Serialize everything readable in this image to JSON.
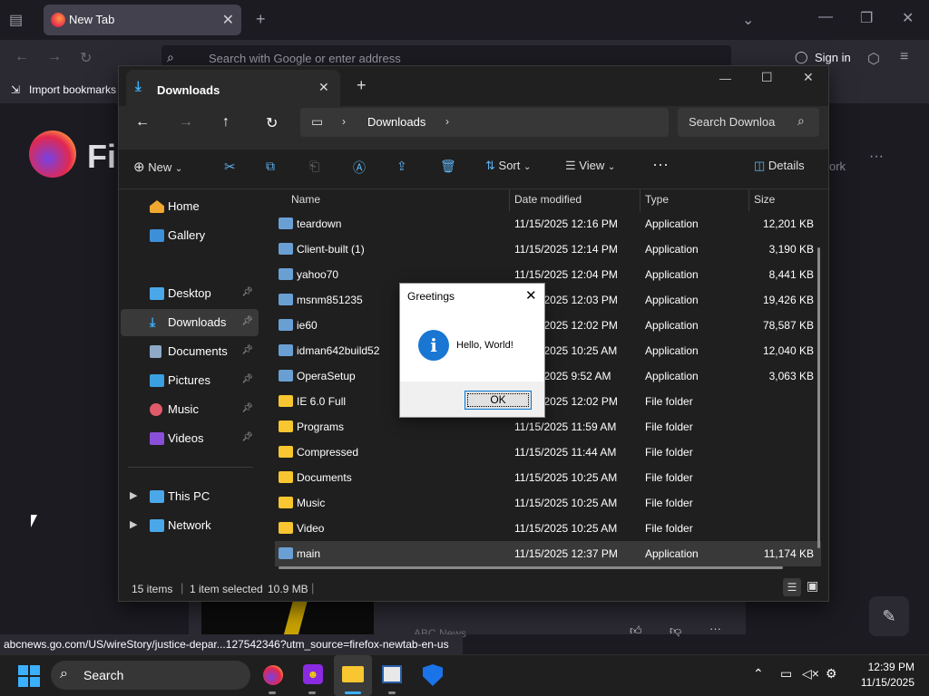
{
  "firefox": {
    "tab_title": "New Tab",
    "url_placeholder": "Search with Google or enter address",
    "sign_in": "Sign in",
    "import_bookmarks": "Import bookmarks",
    "logo_text": "Fir",
    "status_url": "abcnews.go.com/US/wireStory/justice-depar...127542346?utm_source=firefox-newtab-en-us",
    "partial_right_text": "ork",
    "card_source": "ABC News"
  },
  "explorer": {
    "tab_title": "Downloads",
    "breadcrumb": [
      "Downloads"
    ],
    "search_placeholder": "Search Downloa",
    "commands": {
      "new": "New",
      "sort": "Sort",
      "view": "View",
      "details": "Details"
    },
    "nav": [
      {
        "label": "Home",
        "pinned": false
      },
      {
        "label": "Gallery",
        "pinned": false
      },
      {
        "label": "Desktop",
        "pinned": true
      },
      {
        "label": "Downloads",
        "pinned": true,
        "selected": true
      },
      {
        "label": "Documents",
        "pinned": true
      },
      {
        "label": "Pictures",
        "pinned": true
      },
      {
        "label": "Music",
        "pinned": true
      },
      {
        "label": "Videos",
        "pinned": true
      },
      {
        "label": "This PC",
        "pinned": false
      },
      {
        "label": "Network",
        "pinned": false
      }
    ],
    "columns": [
      "Name",
      "Date modified",
      "Type",
      "Size"
    ],
    "files": [
      {
        "name": "teardown",
        "date": "11/15/2025 12:16 PM",
        "type": "Application",
        "size": "12,201 KB"
      },
      {
        "name": "Client-built (1)",
        "date": "11/15/2025 12:14 PM",
        "type": "Application",
        "size": "3,190 KB"
      },
      {
        "name": "yahoo70",
        "date": "11/15/2025 12:04 PM",
        "type": "Application",
        "size": "8,441 KB"
      },
      {
        "name": "msnm851235",
        "date": "11/15/2025 12:03 PM",
        "type": "Application",
        "size": "19,426 KB"
      },
      {
        "name": "ie60",
        "date": "11/15/2025 12:02 PM",
        "type": "Application",
        "size": "78,587 KB"
      },
      {
        "name": "idman642build52",
        "date": "11/15/2025 10:25 AM",
        "type": "Application",
        "size": "12,040 KB"
      },
      {
        "name": "OperaSetup",
        "date": "11/15/2025 9:52 AM",
        "type": "Application",
        "size": "3,063 KB"
      },
      {
        "name": "IE 6.0 Full",
        "date": "11/15/2025 12:02 PM",
        "type": "File folder",
        "size": ""
      },
      {
        "name": "Programs",
        "date": "11/15/2025 11:59 AM",
        "type": "File folder",
        "size": ""
      },
      {
        "name": "Compressed",
        "date": "11/15/2025 11:44 AM",
        "type": "File folder",
        "size": ""
      },
      {
        "name": "Documents",
        "date": "11/15/2025 10:25 AM",
        "type": "File folder",
        "size": ""
      },
      {
        "name": "Music",
        "date": "11/15/2025 10:25 AM",
        "type": "File folder",
        "size": ""
      },
      {
        "name": "Video",
        "date": "11/15/2025 10:25 AM",
        "type": "File folder",
        "size": ""
      },
      {
        "name": "main",
        "date": "11/15/2025 12:37 PM",
        "type": "Application",
        "size": "11,174 KB",
        "selected": true
      }
    ],
    "status": {
      "items": "15 items",
      "selected": "1 item selected",
      "size": "10.9 MB"
    }
  },
  "dialog": {
    "title": "Greetings",
    "message": "Hello, World!",
    "ok": "OK"
  },
  "taskbar": {
    "search": "Search",
    "time": "12:39 PM",
    "date": "11/15/2025"
  },
  "colors": {
    "accent": "#0067c0",
    "folder": "#f8c630",
    "selected_row": "#393939"
  }
}
